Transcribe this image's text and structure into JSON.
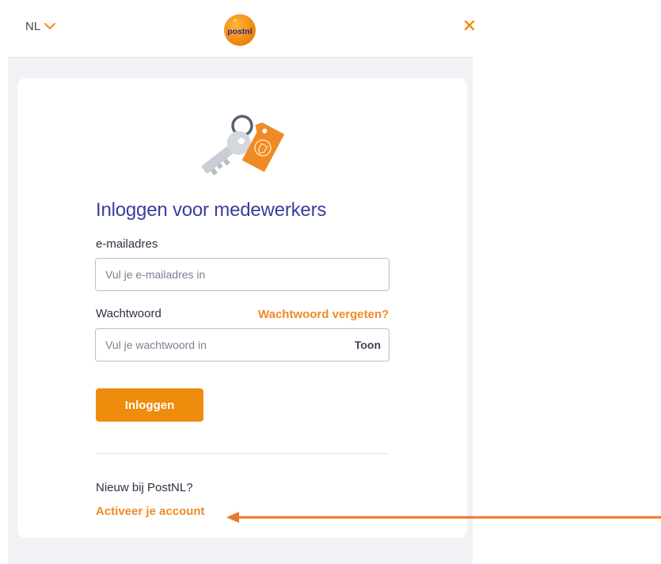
{
  "header": {
    "language": "NL",
    "logo_text": "postnl"
  },
  "login": {
    "title": "Inloggen voor medewerkers",
    "email_label": "e-mailadres",
    "email_placeholder": "Vul je e-mailadres in",
    "password_label": "Wachtwoord",
    "forgot_link": "Wachtwoord vergeten?",
    "password_placeholder": "Vul je wachtwoord in",
    "show_password": "Toon",
    "submit": "Inloggen",
    "new_user_text": "Nieuw bij PostNL?",
    "activate_link": "Activeer je account"
  },
  "colors": {
    "accent": "#ef8b0d",
    "title": "#3d3d9e",
    "panel": "#f0f2f5",
    "annotation_arrow": "#e8772e"
  },
  "icons": [
    "chevron-down-icon",
    "postnl-logo",
    "close-icon",
    "keys-illustration",
    "annotation-arrow"
  ]
}
